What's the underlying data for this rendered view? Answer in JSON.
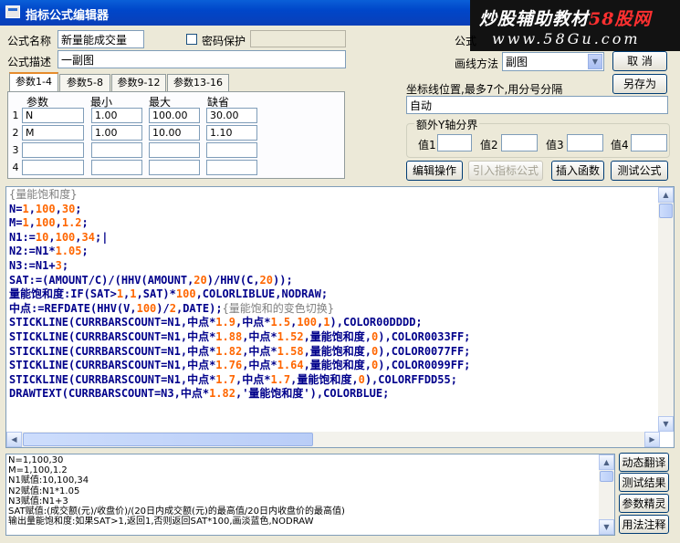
{
  "window": {
    "title": "指标公式编辑器"
  },
  "watermark": {
    "line1_a": "炒股辅助教材",
    "line1_b": "58股网",
    "line2": "www.58Gu.com"
  },
  "form": {
    "name_label": "公式名称",
    "name_value": "新量能成交量",
    "password_label": "密码保护",
    "password_checked": false,
    "desc_label": "公式描述",
    "desc_value": "一副图",
    "partial_label": "公式",
    "draw_method_label": "画线方法",
    "draw_method_value": "副图"
  },
  "buttons": {
    "cancel": "取  消",
    "save_as": "另存为",
    "edit_op": "编辑操作",
    "import": "引入指标公式",
    "insert_fn": "插入函数",
    "test": "测试公式",
    "dyn_translate": "动态翻译",
    "test_result": "测试结果",
    "param_detail": "参数精灵",
    "usage_note": "用法注释"
  },
  "tabs": [
    "参数1-4",
    "参数5-8",
    "参数9-12",
    "参数13-16"
  ],
  "params": {
    "headers": [
      "参数",
      "最小",
      "最大",
      "缺省"
    ],
    "rows": [
      {
        "num": "1",
        "name": "N",
        "min": "1.00",
        "max": "100.00",
        "def": "30.00"
      },
      {
        "num": "2",
        "name": "M",
        "min": "1.00",
        "max": "10.00",
        "def": "1.10"
      },
      {
        "num": "3",
        "name": "",
        "min": "",
        "max": "",
        "def": ""
      },
      {
        "num": "4",
        "name": "",
        "min": "",
        "max": "",
        "def": ""
      }
    ]
  },
  "axis": {
    "label": "坐标线位置,最多7个,用分号分隔",
    "value": "自动",
    "extra_group_title": "额外Y轴分界",
    "vals": [
      "值1",
      "值2",
      "值3",
      "值4"
    ]
  },
  "code_lines": [
    [
      {
        "t": "{量能饱和度}",
        "c": "cm"
      }
    ],
    [
      {
        "t": "N=",
        "c": "k"
      },
      {
        "t": "1",
        "c": "n"
      },
      {
        "t": ",",
        "c": "o"
      },
      {
        "t": "100",
        "c": "n"
      },
      {
        "t": ",",
        "c": "o"
      },
      {
        "t": "30",
        "c": "n"
      },
      {
        "t": ";",
        "c": "o"
      }
    ],
    [
      {
        "t": "M=",
        "c": "k"
      },
      {
        "t": "1",
        "c": "n"
      },
      {
        "t": ",",
        "c": "o"
      },
      {
        "t": "100",
        "c": "n"
      },
      {
        "t": ",",
        "c": "o"
      },
      {
        "t": "1.2",
        "c": "n"
      },
      {
        "t": ";",
        "c": "o"
      }
    ],
    [
      {
        "t": "N1:=",
        "c": "k"
      },
      {
        "t": "10",
        "c": "n"
      },
      {
        "t": ",",
        "c": "o"
      },
      {
        "t": "100",
        "c": "n"
      },
      {
        "t": ",",
        "c": "o"
      },
      {
        "t": "34",
        "c": "n"
      },
      {
        "t": ";|",
        "c": "o"
      }
    ],
    [
      {
        "t": "N2:=N1*",
        "c": "k"
      },
      {
        "t": "1.05",
        "c": "n"
      },
      {
        "t": ";",
        "c": "o"
      }
    ],
    [
      {
        "t": "N3:=N1+",
        "c": "k"
      },
      {
        "t": "3",
        "c": "n"
      },
      {
        "t": ";",
        "c": "o"
      }
    ],
    [
      {
        "t": "SAT:=(AMOUNT/C)/(HHV(AMOUNT,",
        "c": "k"
      },
      {
        "t": "20",
        "c": "n"
      },
      {
        "t": ")/HHV(C,",
        "c": "k"
      },
      {
        "t": "20",
        "c": "n"
      },
      {
        "t": "));",
        "c": "k"
      }
    ],
    [
      {
        "t": "量能饱和度:IF(SAT>",
        "c": "k"
      },
      {
        "t": "1",
        "c": "n"
      },
      {
        "t": ",",
        "c": "o"
      },
      {
        "t": "1",
        "c": "n"
      },
      {
        "t": ",SAT)*",
        "c": "k"
      },
      {
        "t": "100",
        "c": "n"
      },
      {
        "t": ",COLORLIBLUE,NODRAW;",
        "c": "k"
      }
    ],
    [
      {
        "t": "中点:=REFDATE(HHV(V,",
        "c": "k"
      },
      {
        "t": "100",
        "c": "n"
      },
      {
        "t": ")/",
        "c": "k"
      },
      {
        "t": "2",
        "c": "n"
      },
      {
        "t": ",DATE);",
        "c": "k"
      },
      {
        "t": "{量能饱和的变色切换}",
        "c": "cm"
      }
    ],
    [
      {
        "t": "STICKLINE(CURRBARSCOUNT=N1,中点*",
        "c": "k"
      },
      {
        "t": "1.9",
        "c": "n"
      },
      {
        "t": ",中点*",
        "c": "k"
      },
      {
        "t": "1.5",
        "c": "n"
      },
      {
        "t": ",",
        "c": "o"
      },
      {
        "t": "100",
        "c": "n"
      },
      {
        "t": ",",
        "c": "o"
      },
      {
        "t": "1",
        "c": "n"
      },
      {
        "t": "),COLOR00DDDD;",
        "c": "k"
      }
    ],
    [
      {
        "t": "STICKLINE(CURRBARSCOUNT=N1,中点*",
        "c": "k"
      },
      {
        "t": "1.88",
        "c": "n"
      },
      {
        "t": ",中点*",
        "c": "k"
      },
      {
        "t": "1.52",
        "c": "n"
      },
      {
        "t": ",量能饱和度,",
        "c": "k"
      },
      {
        "t": "0",
        "c": "n"
      },
      {
        "t": "),COLOR0033FF;",
        "c": "k"
      }
    ],
    [
      {
        "t": "STICKLINE(CURRBARSCOUNT=N1,中点*",
        "c": "k"
      },
      {
        "t": "1.82",
        "c": "n"
      },
      {
        "t": ",中点*",
        "c": "k"
      },
      {
        "t": "1.58",
        "c": "n"
      },
      {
        "t": ",量能饱和度,",
        "c": "k"
      },
      {
        "t": "0",
        "c": "n"
      },
      {
        "t": "),COLOR0077FF;",
        "c": "k"
      }
    ],
    [
      {
        "t": "STICKLINE(CURRBARSCOUNT=N1,中点*",
        "c": "k"
      },
      {
        "t": "1.76",
        "c": "n"
      },
      {
        "t": ",中点*",
        "c": "k"
      },
      {
        "t": "1.64",
        "c": "n"
      },
      {
        "t": ",量能饱和度,",
        "c": "k"
      },
      {
        "t": "0",
        "c": "n"
      },
      {
        "t": "),COLOR0099FF;",
        "c": "k"
      }
    ],
    [
      {
        "t": "STICKLINE(CURRBARSCOUNT=N1,中点*",
        "c": "k"
      },
      {
        "t": "1.7",
        "c": "n"
      },
      {
        "t": ",中点*",
        "c": "k"
      },
      {
        "t": "1.7",
        "c": "n"
      },
      {
        "t": ",量能饱和度,",
        "c": "k"
      },
      {
        "t": "0",
        "c": "n"
      },
      {
        "t": "),COLORFFDD55;",
        "c": "k"
      }
    ],
    [
      {
        "t": "DRAWTEXT(CURRBARSCOUNT=N3,中点*",
        "c": "k"
      },
      {
        "t": "1.82",
        "c": "n"
      },
      {
        "t": ",'量能饱和度'),COLORBLUE;",
        "c": "k"
      }
    ]
  ],
  "output_lines": [
    "N=1,100,30",
    "M=1,100,1.2",
    "N1赋值:10,100,34",
    "N2赋值:N1*1.05",
    "N3赋值:N1+3",
    "SAT赋值:(成交额(元)/收盘价)/(20日内成交额(元)的最高值/20日内收盘价的最高值)",
    "输出量能饱和度:如果SAT>1,返回1,否则返回SAT*100,画淡蓝色,NODRAW"
  ],
  "colors": {
    "keyword": "#00008b",
    "number": "#ff6600",
    "comment": "#808080",
    "title_bar": "#0046c9"
  },
  "icons": {
    "window": "app-window-icon",
    "dropdown": "chevron-down-icon"
  }
}
